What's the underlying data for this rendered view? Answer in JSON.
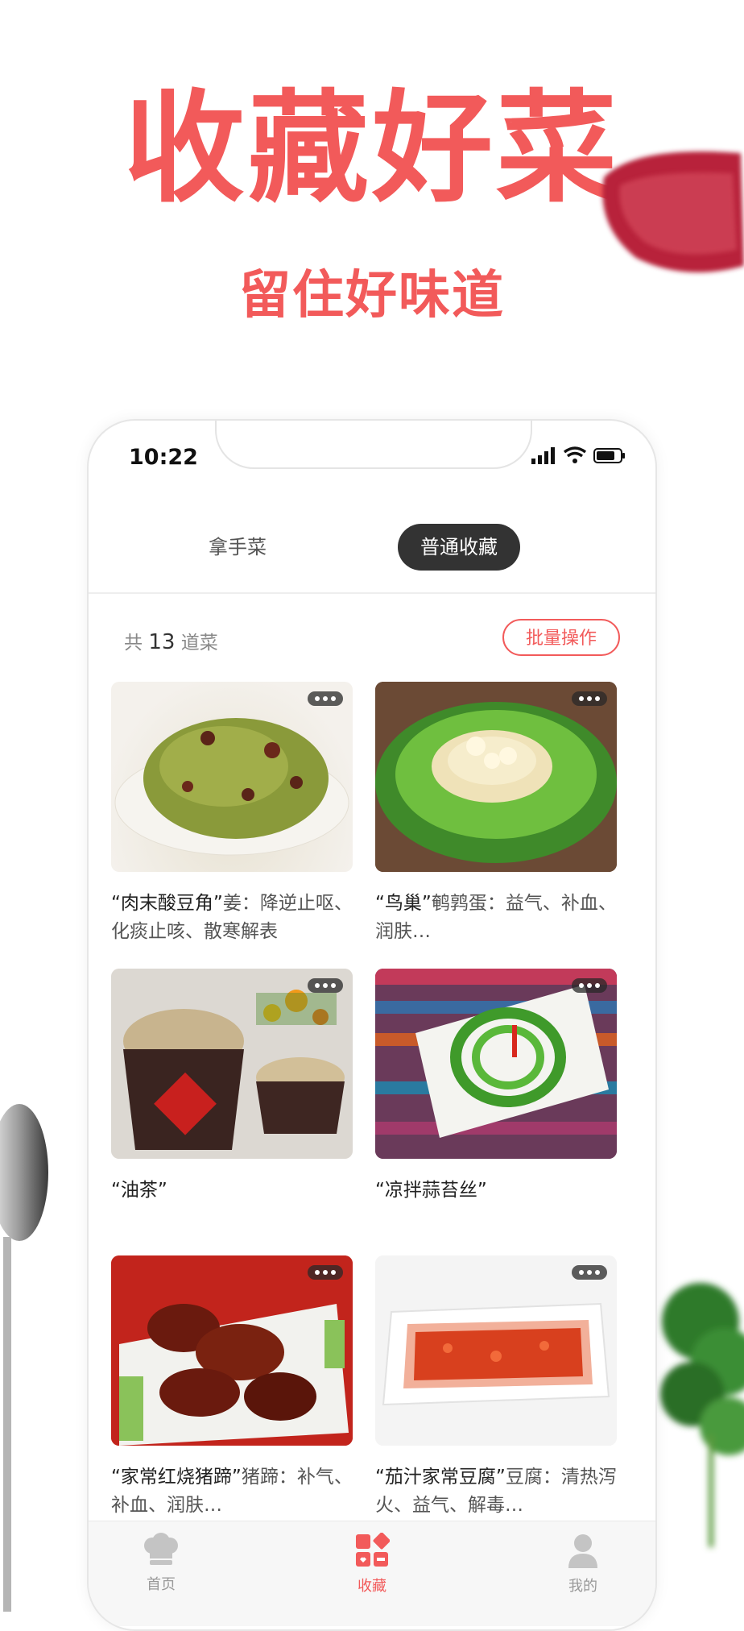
{
  "hero": {
    "title": "收藏好菜",
    "subtitle": "留住好味道"
  },
  "status_bar": {
    "time": "10:22"
  },
  "tabs": [
    {
      "label": "拿手菜"
    },
    {
      "label": "普通收藏"
    }
  ],
  "summary": {
    "prefix": "共",
    "count": "13",
    "suffix": "道菜",
    "batch_label": "批量操作"
  },
  "dishes": [
    {
      "name": "“肉末酸豆角”",
      "desc": "姜：降逆止呕、化痰止咳、散寒解表"
    },
    {
      "name": "“鸟巢”",
      "desc": "鹌鹑蛋：益气、补血、润肤…"
    },
    {
      "name": "“油茶”",
      "desc": ""
    },
    {
      "name": "“凉拌蒜苔丝”",
      "desc": ""
    },
    {
      "name": "“家常红烧猪蹄”",
      "desc": "猪蹄：补气、补血、润肤…"
    },
    {
      "name": "“茄汁家常豆腐”",
      "desc": "豆腐：清热泻火、益气、解毒…"
    }
  ],
  "nav": [
    {
      "label": "首页",
      "icon": "chef-hat-icon"
    },
    {
      "label": "收藏",
      "icon": "collection-icon"
    },
    {
      "label": "我的",
      "icon": "profile-icon"
    }
  ],
  "colors": {
    "accent": "#f25a5a",
    "active_tab": "#333333"
  }
}
